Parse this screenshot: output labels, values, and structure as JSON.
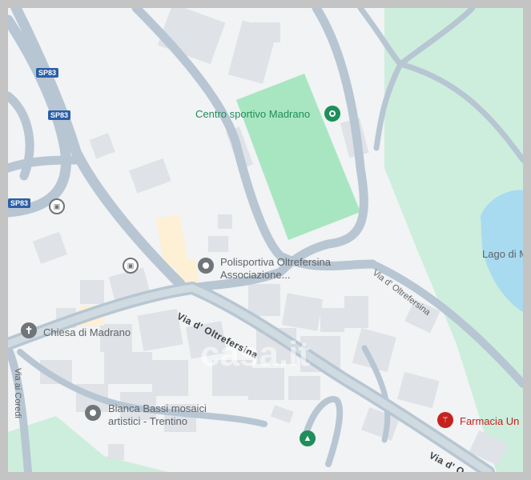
{
  "map": {
    "pois": {
      "sports_center": "Centro sportivo Madrano",
      "polisportiva_line1": "Polisportiva Oltrefersina",
      "polisportiva_line2": "Associazione...",
      "church": "Chiesa di Madrano",
      "bianca_line1": "Bianca Bassi mosaici",
      "bianca_line2": "artistici - Trentino",
      "pharmacy": "Farmacia Un",
      "lake": "Lago di M"
    },
    "streets": {
      "main_street": "Via d' Oltrefersina",
      "main_street_lower": "Via d' O",
      "side_street": "Via d' Oltrefersina",
      "coredi": "Via ai Coredi"
    },
    "road_shields": [
      "SP83",
      "SP83",
      "SP83"
    ],
    "watermark": "casa.it",
    "colors": {
      "background": "#f1f3f4",
      "road": "#aebfcc",
      "park": "#cdeedd",
      "field": "#a8e6c1",
      "water": "#a8daf0",
      "building": "#dfe2e6",
      "highlight_building": "#fdf0d5",
      "poi_green": "#1e8e5a",
      "poi_red": "#c5221f",
      "poi_gray": "#70757a",
      "shield": "#2d5fa8"
    },
    "icons": [
      "pin-icon",
      "bus-stop-icon",
      "cross-icon",
      "tree-icon",
      "pharmacy-icon"
    ]
  }
}
